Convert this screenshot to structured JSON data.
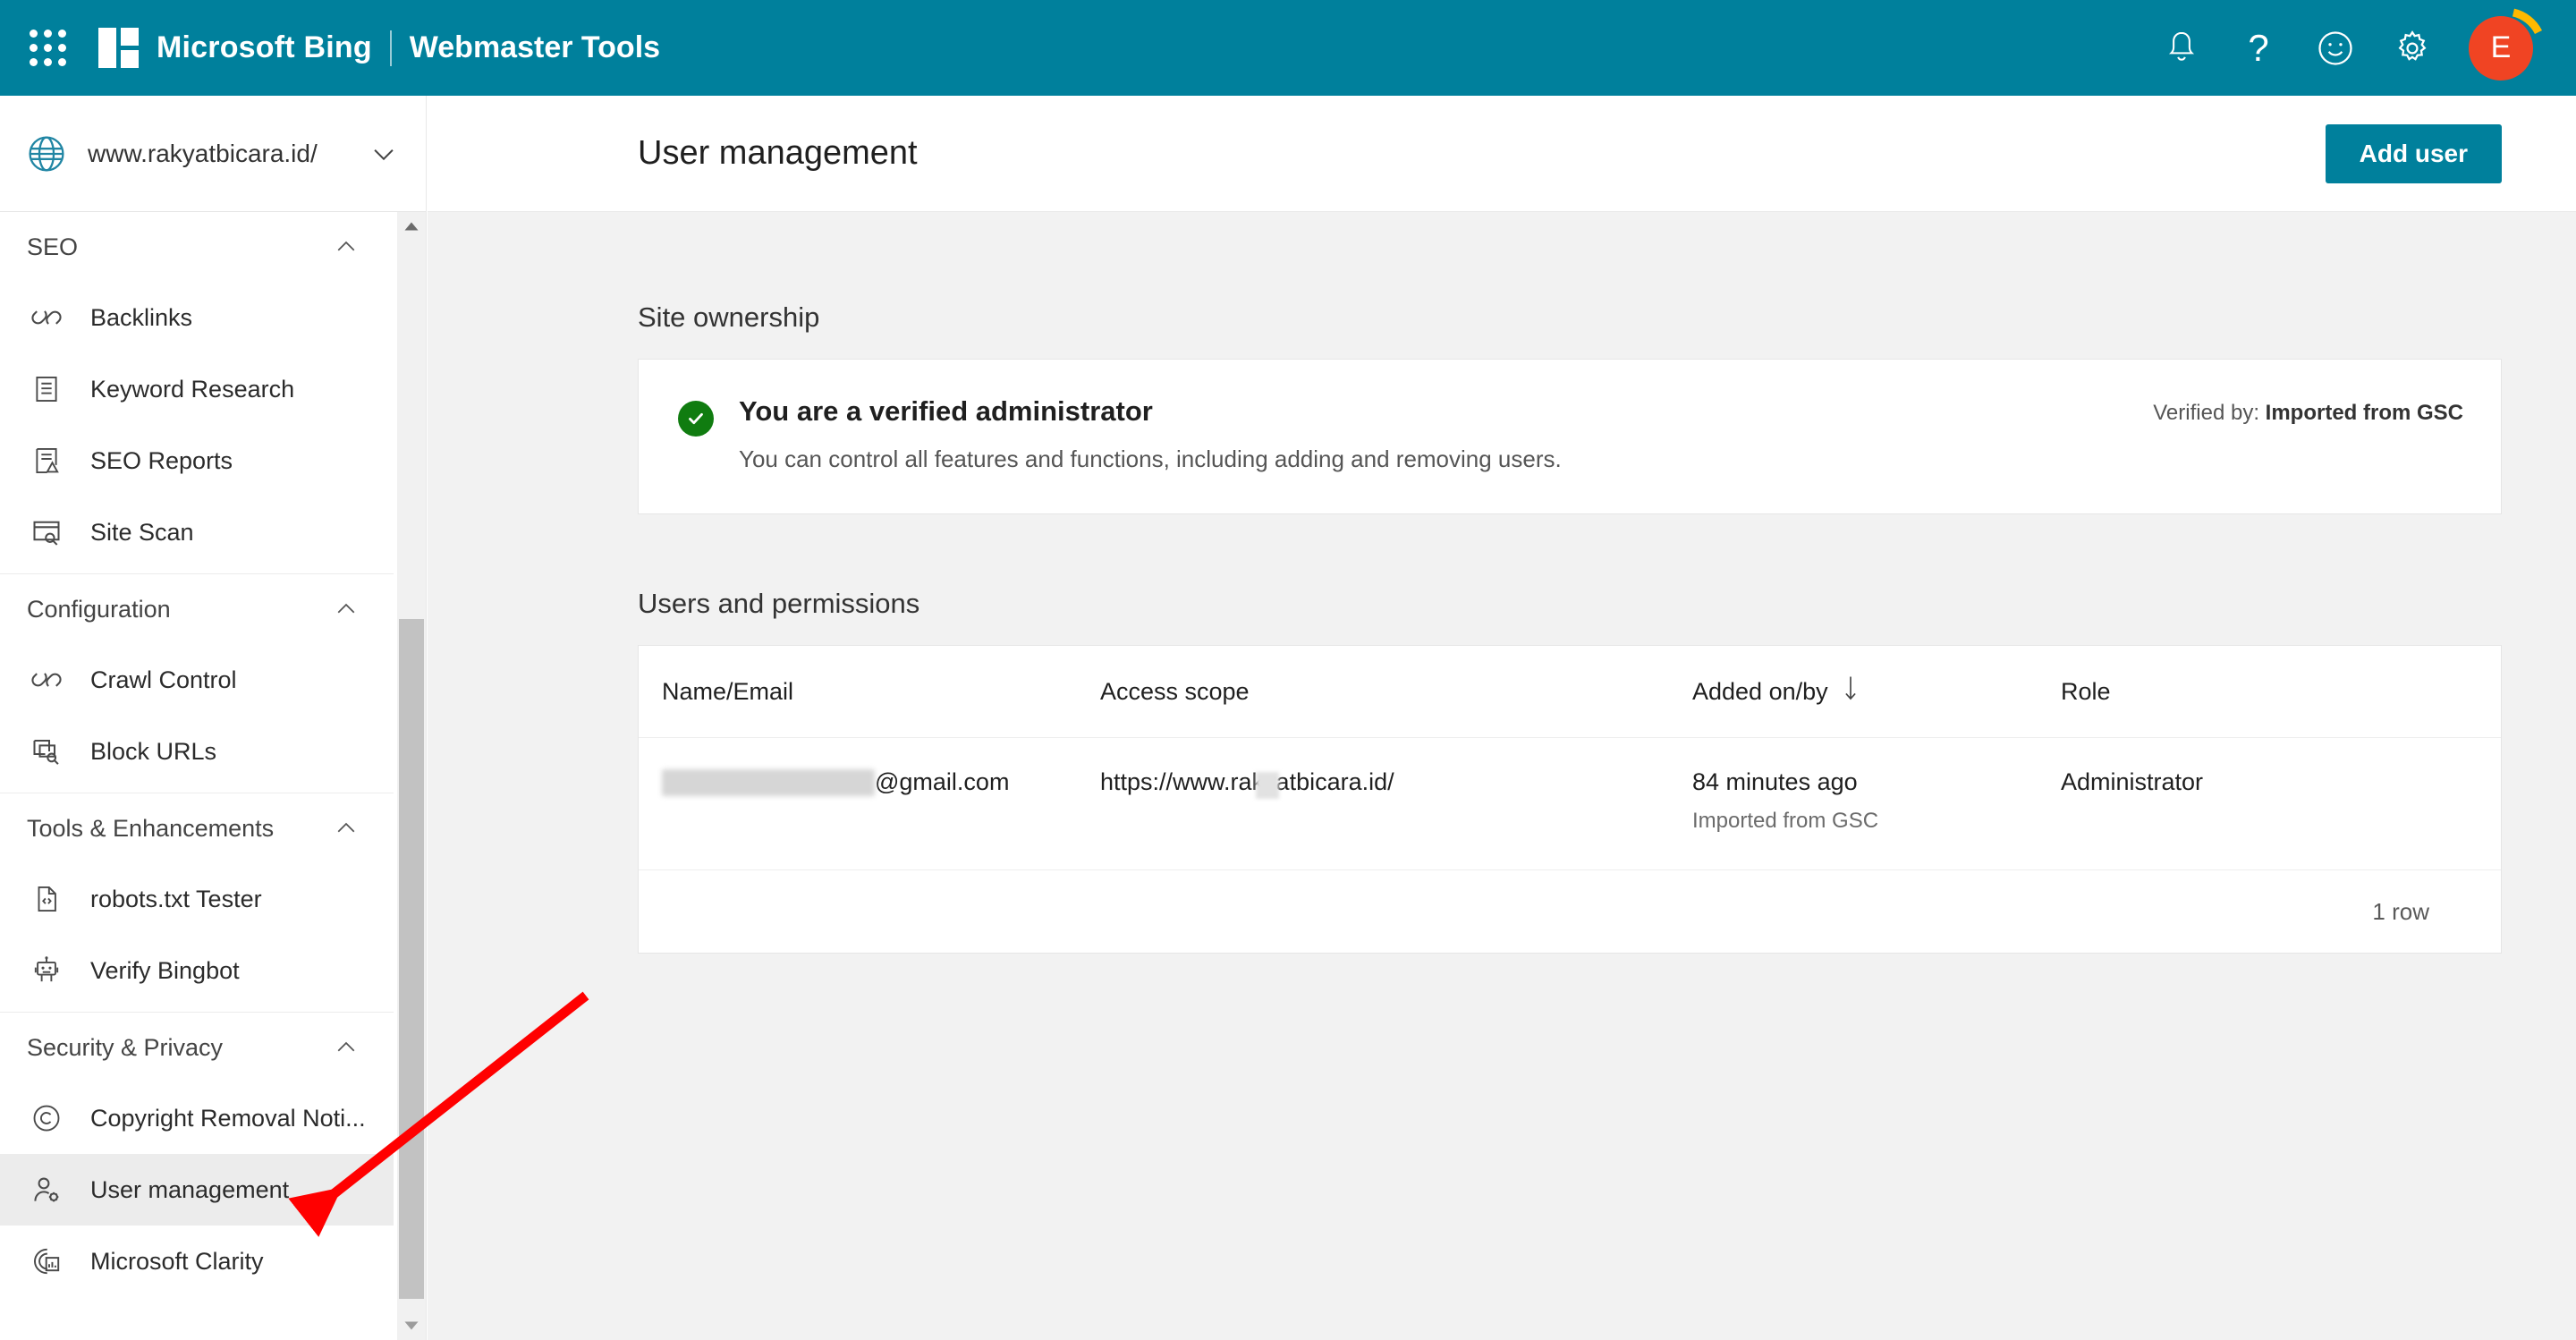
{
  "topbar": {
    "waffle_label": "App launcher",
    "brand": "Microsoft Bing",
    "brand_sub": "Webmaster Tools",
    "icons": {
      "notifications": "bell-icon",
      "help": "?",
      "feedback": "smiley-icon",
      "settings": "gear-icon"
    },
    "avatar_initial": "E",
    "accent_color": "#00809C",
    "avatar_color": "#F04423"
  },
  "sidebar": {
    "site": {
      "url": "www.rakyatbicara.id/",
      "icon": "globe-icon",
      "chevron": "chevron-down-icon"
    },
    "groups": [
      {
        "title": "SEO",
        "items": [
          {
            "label": "Backlinks",
            "icon": "link-icon"
          },
          {
            "label": "Keyword Research",
            "icon": "list-document-icon"
          },
          {
            "label": "SEO Reports",
            "icon": "report-warning-icon"
          },
          {
            "label": "Site Scan",
            "icon": "window-search-icon"
          }
        ]
      },
      {
        "title": "Configuration",
        "items": [
          {
            "label": "Crawl Control",
            "icon": "link-icon"
          },
          {
            "label": "Block URLs",
            "icon": "windows-search-icon"
          }
        ]
      },
      {
        "title": "Tools & Enhancements",
        "items": [
          {
            "label": "robots.txt Tester",
            "icon": "code-file-icon"
          },
          {
            "label": "Verify Bingbot",
            "icon": "robot-icon"
          }
        ]
      },
      {
        "title": "Security & Privacy",
        "items": [
          {
            "label": "Copyright Removal Noti...",
            "icon": "copyright-icon"
          },
          {
            "label": "User management",
            "icon": "user-settings-icon",
            "selected": true
          },
          {
            "label": "Microsoft Clarity",
            "icon": "clarity-icon"
          }
        ]
      }
    ]
  },
  "page": {
    "title": "User management",
    "add_user_label": "Add user"
  },
  "ownership": {
    "section_title": "Site ownership",
    "status_title": "You are a verified administrator",
    "status_desc": "You can control all features and functions, including adding and removing users.",
    "verified_by_label": "Verified by:",
    "verified_by_value": "Imported from GSC",
    "check_icon": "check-circle-icon"
  },
  "users": {
    "section_title": "Users and permissions",
    "columns": [
      {
        "label": "Name/Email",
        "sorted": false
      },
      {
        "label": "Access scope",
        "sorted": false
      },
      {
        "label": "Added on/by",
        "sorted": true,
        "sort_icon": "arrow-down-icon"
      },
      {
        "label": "Role",
        "sorted": false
      }
    ],
    "rows": [
      {
        "email": "@gmail.com",
        "email_redacted": true,
        "access_scope": "https://www.rakyatbicara.id/",
        "added_on": "84 minutes ago",
        "added_by": "Imported from GSC",
        "role": "Administrator"
      }
    ],
    "row_count": "1 row"
  },
  "annotation": {
    "arrow_color": "#FF0000",
    "points_to": "User management"
  }
}
